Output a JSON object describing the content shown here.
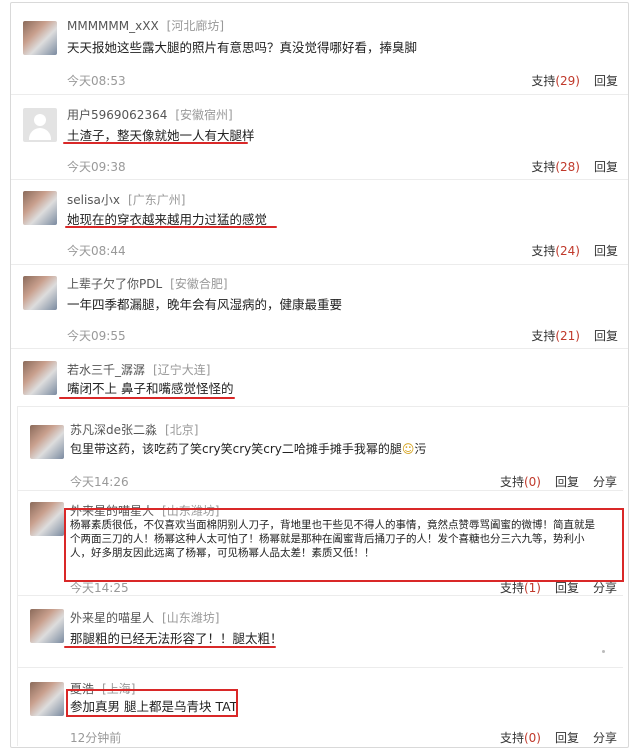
{
  "comments": [
    {
      "user": "MMMMMM_xXX",
      "location": "[河北廊坊]",
      "text": "天天报她这些露大腿的照片有意思吗？真没觉得哪好看，捧臭脚",
      "time": "今天08:53",
      "support_label": "支持",
      "support_count": "(29)",
      "reply_label": "回复"
    },
    {
      "user": "用户5969062364",
      "location": "[安徽宿州]",
      "text": "土渣子，整天像就她一人有大腿样",
      "time": "今天09:38",
      "support_label": "支持",
      "support_count": "(28)",
      "reply_label": "回复"
    },
    {
      "user": "selisa小x",
      "location": "[广东广州]",
      "text": "她现在的穿衣越来越用力过猛的感觉",
      "time": "今天08:44",
      "support_label": "支持",
      "support_count": "(24)",
      "reply_label": "回复"
    },
    {
      "user": "上辈子欠了你PDL",
      "location": "[安徽合肥]",
      "text": "一年四季都漏腿，晚年会有风湿病的，健康最重要",
      "time": "今天09:55",
      "support_label": "支持",
      "support_count": "(21)",
      "reply_label": "回复"
    },
    {
      "user": "若水三千_潺潺",
      "location": "[辽宁大连]",
      "text": "嘴闭不上 鼻子和嘴感觉怪怪的"
    }
  ],
  "replies": [
    {
      "user": "苏凡深de张二淼",
      "location": "[北京]",
      "text": "包里带这药，该吃药了笑cry笑cry笑cry二哈摊手摊手我幂的腿",
      "emoji": "☺",
      "tail": "污",
      "time": "今天14:26",
      "support_label": "支持",
      "support_count": "(0)",
      "reply_label": "回复",
      "share_label": "分享"
    },
    {
      "user": "外来星的喵星人",
      "location": "[山东潍坊]",
      "text_lines": [
        "杨幂素质很低，不仅喜欢当面棉阴别人刀子，背地里也干些见不得人的事情，竟然点赞辱骂阖蜜的微博！简直就是",
        "个两面三刀的人！杨幂这种人太可怕了！杨幂就是那种在阖蜜背后捅刀子的人！发个喜糖也分三六九等，势利小",
        "人，好多朋友因此远离了杨幂，可见杨幂人品太差！素质又低！！"
      ],
      "time": "今天14:25",
      "support_label": "支持",
      "support_count": "(1)",
      "reply_label": "回复",
      "share_label": "分享"
    },
    {
      "user": "外来星的喵星人",
      "location": "[山东潍坊]",
      "text": "那腿粗的已经无法形容了！！腿太粗！"
    },
    {
      "user": "夏浩",
      "location": "[上海]",
      "text": "参加真男 腿上都是乌青块 TAT",
      "time": "12分钟前",
      "support_label": "支持",
      "support_count": "(0)",
      "reply_label": "回复",
      "share_label": "分享"
    }
  ],
  "colors": {
    "accent": "#d92828",
    "count": "#c0392b",
    "meta": "#999999"
  }
}
